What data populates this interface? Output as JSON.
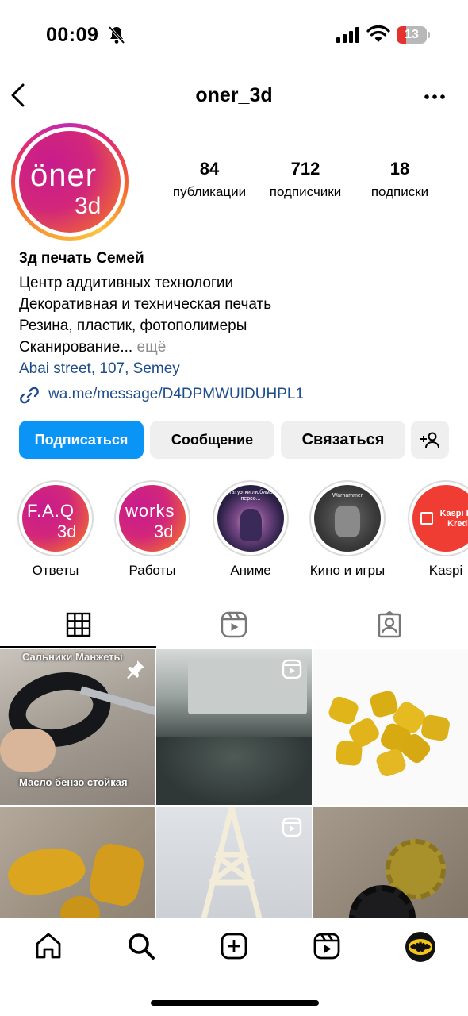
{
  "status_bar": {
    "time": "00:09",
    "battery_level": "13",
    "icons": [
      "bell-slash-icon",
      "signal-icon",
      "wifi-icon",
      "battery-icon"
    ]
  },
  "header": {
    "username": "oner_3d",
    "back_icon": "chevron-left-icon",
    "more_icon": "ellipsis-icon"
  },
  "avatar": {
    "logo_line1": "öner",
    "logo_line2": "3d"
  },
  "stats": {
    "posts": {
      "value": "84",
      "label": "публикации"
    },
    "followers": {
      "value": "712",
      "label": "подписчики"
    },
    "following": {
      "value": "18",
      "label": "подписки"
    }
  },
  "bio": {
    "name": "3д печать Семей",
    "lines": [
      "Центр аддитивных технологии",
      "Декоративная и техническая печать",
      "Резина, пластик, фотополимеры",
      "Сканирование..."
    ],
    "more": "ещё",
    "address": "Abai street, 107, Semey",
    "link": "wa.me/message/D4DPMWUIDUHPL1"
  },
  "buttons": {
    "follow": "Подписаться",
    "message": "Сообщение",
    "contact": "Связаться",
    "add_user_icon": "add-user-icon"
  },
  "highlights": [
    {
      "label": "Ответы",
      "cover_line1": "F.A.Q",
      "cover_line2": "3d"
    },
    {
      "label": "Работы",
      "cover_line1": "works",
      "cover_line2": "3d"
    },
    {
      "label": "Аниме",
      "cover_text": "Статуэтки любимых персо..."
    },
    {
      "label": "Кино и игры",
      "cover_text": "Warhammer"
    },
    {
      "label": "Kaspi",
      "cover_text": "Kaspi R и Kredit"
    }
  ],
  "tabs": [
    {
      "icon": "grid-icon",
      "active": true
    },
    {
      "icon": "reels-icon",
      "active": false
    },
    {
      "icon": "tagged-icon",
      "active": false
    }
  ],
  "posts": [
    {
      "caption_top": "Сальники Манжеты",
      "caption_bottom": "Масло бензо стойкая",
      "badge": "pin-icon"
    },
    {
      "badge": "reels-icon"
    },
    {},
    {},
    {
      "badge": "reels-icon"
    },
    {}
  ],
  "bottom_nav": [
    "home-icon",
    "search-icon",
    "create-icon",
    "reels-icon",
    "profile-avatar"
  ],
  "colors": {
    "primary_button": "#0a95f6",
    "link": "#1e4d8c",
    "secondary_button": "#efefef",
    "battery_low": "#e5312f"
  }
}
